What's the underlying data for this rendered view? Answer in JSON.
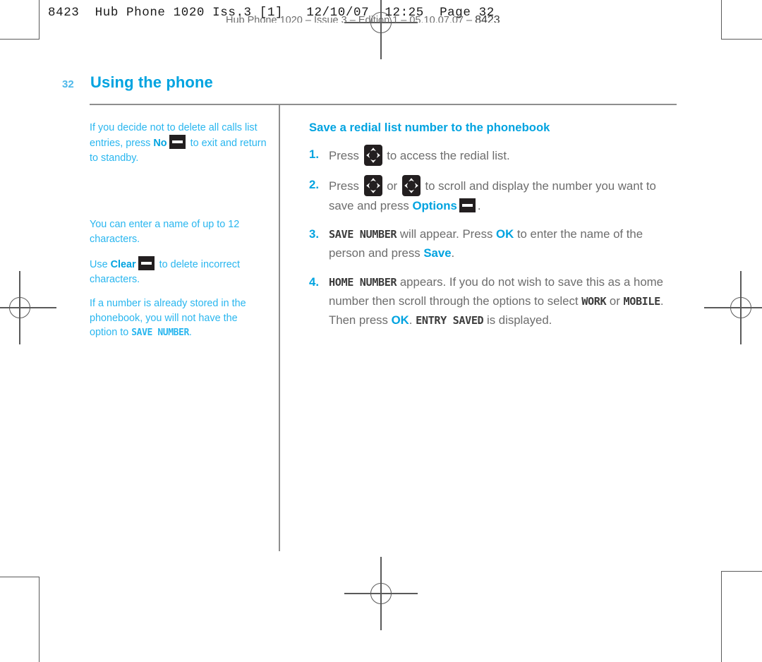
{
  "prepress": {
    "job_slug": "8423  Hub Phone 1020 Iss.3 [1]   12/10/07  12:25  Page 32",
    "running_foot": "Hub Phone 1020 – Issue 3 – Edition 1 – 05.10.07.07 – ",
    "running_foot_number": "8423"
  },
  "page": {
    "folio": "32",
    "chapter_title": "Using the phone"
  },
  "sidebar": {
    "notes": [
      {
        "id": "note-delete-calls-list",
        "parts": [
          {
            "type": "text",
            "value": "If you decide not to delete all calls list entries, press "
          },
          {
            "type": "bold",
            "value": "No"
          },
          {
            "type": "key",
            "value": "softkey-icon"
          },
          {
            "type": "text",
            "value": " to exit and return to standby."
          }
        ]
      },
      {
        "id": "note-name-length",
        "parts": [
          {
            "type": "text",
            "value": "You can enter a name of up to 12 characters."
          }
        ]
      },
      {
        "id": "note-clear-characters",
        "parts": [
          {
            "type": "text",
            "value": "Use "
          },
          {
            "type": "bold",
            "value": "Clear"
          },
          {
            "type": "key",
            "value": "softkey-icon"
          },
          {
            "type": "text",
            "value": " to delete incorrect characters."
          }
        ]
      },
      {
        "id": "note-already-stored",
        "parts": [
          {
            "type": "text",
            "value": "If a number is already stored in the phonebook, you will not have the option to "
          },
          {
            "type": "lcd",
            "value": "SAVE NUMBER"
          },
          {
            "type": "text",
            "value": "."
          }
        ]
      }
    ]
  },
  "main": {
    "section_title": "Save a redial list number to the phonebook",
    "steps": [
      {
        "number": "1.",
        "parts": [
          {
            "type": "text",
            "value": "Press "
          },
          {
            "type": "key",
            "value": "nav-key-icon"
          },
          {
            "type": "text",
            "value": " to access the redial list."
          }
        ]
      },
      {
        "number": "2.",
        "parts": [
          {
            "type": "text",
            "value": "Press "
          },
          {
            "type": "key",
            "value": "nav-key-icon"
          },
          {
            "type": "text",
            "value": " or "
          },
          {
            "type": "key",
            "value": "nav-key-icon"
          },
          {
            "type": "text",
            "value": " to scroll and display the number you want to save and press "
          },
          {
            "type": "bold",
            "value": "Options"
          },
          {
            "type": "key",
            "value": "softkey-icon"
          },
          {
            "type": "text",
            "value": "."
          }
        ]
      },
      {
        "number": "3.",
        "parts": [
          {
            "type": "lcd",
            "value": "SAVE NUMBER"
          },
          {
            "type": "text",
            "value": " will appear. Press "
          },
          {
            "type": "bold",
            "value": "OK"
          },
          {
            "type": "text",
            "value": " to enter the name of the person and press "
          },
          {
            "type": "bold",
            "value": "Save"
          },
          {
            "type": "text",
            "value": "."
          }
        ]
      },
      {
        "number": "4.",
        "parts": [
          {
            "type": "lcd",
            "value": "HOME NUMBER"
          },
          {
            "type": "text",
            "value": " appears. If you do not wish to save this as a home number then scroll through the options to select "
          },
          {
            "type": "lcd",
            "value": "WORK"
          },
          {
            "type": "text",
            "value": " or "
          },
          {
            "type": "lcd",
            "value": "MOBILE"
          },
          {
            "type": "text",
            "value": ". Then press "
          },
          {
            "type": "bold",
            "value": "OK"
          },
          {
            "type": "text",
            "value": ". "
          },
          {
            "type": "lcd",
            "value": "ENTRY SAVED"
          },
          {
            "type": "text",
            "value": " is displayed."
          }
        ]
      }
    ]
  },
  "colors": {
    "accent_cyan": "#00a3e0",
    "note_cyan": "#29b6ef",
    "body_gray": "#6d6d6d",
    "key_black": "#231f20",
    "rule_gray": "#8e8e8e"
  }
}
